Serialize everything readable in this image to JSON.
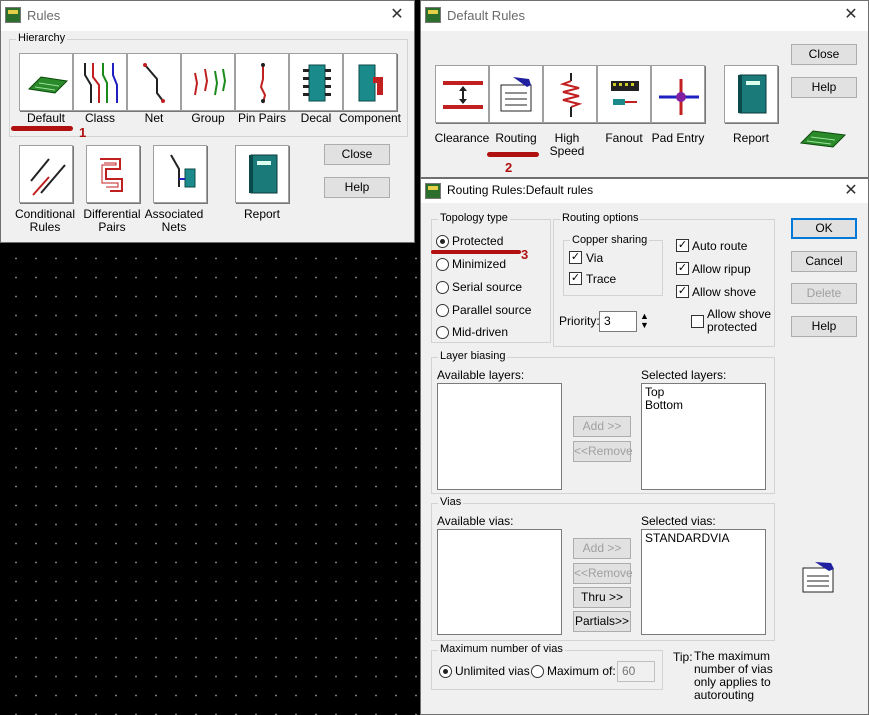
{
  "rules": {
    "title": "Rules",
    "hierarchy_label": "Hierarchy",
    "tiles": [
      {
        "label": "Default"
      },
      {
        "label": "Class"
      },
      {
        "label": "Net"
      },
      {
        "label": "Group"
      },
      {
        "label": "Pin Pairs"
      },
      {
        "label": "Decal"
      },
      {
        "label": "Component"
      }
    ],
    "tiles2": [
      {
        "label": "Conditional Rules"
      },
      {
        "label": "Differential Pairs"
      },
      {
        "label": "Associated Nets"
      },
      {
        "label": "Report"
      }
    ],
    "close_label": "Close",
    "help_label": "Help"
  },
  "default_rules": {
    "title": "Default Rules",
    "tiles": [
      {
        "label": "Clearance"
      },
      {
        "label": "Routing"
      },
      {
        "label": "High Speed"
      },
      {
        "label": "Fanout"
      },
      {
        "label": "Pad Entry"
      },
      {
        "label": "Report"
      }
    ],
    "close_label": "Close",
    "help_label": "Help"
  },
  "routing": {
    "title": "Routing Rules:Default rules",
    "topology_label": "Topology type",
    "topology_options": [
      "Protected",
      "Minimized",
      "Serial source",
      "Parallel source",
      "Mid-driven"
    ],
    "routing_options_label": "Routing options",
    "copper_sharing_label": "Copper sharing",
    "via_label": "Via",
    "trace_label": "Trace",
    "auto_route_label": "Auto route",
    "allow_ripup_label": "Allow ripup",
    "allow_shove_label": "Allow shove",
    "allow_shove_protected_label": "Allow shove protected",
    "priority_label": "Priority:",
    "priority_value": "3",
    "layer_biasing_label": "Layer biasing",
    "available_layers_label": "Available layers:",
    "selected_layers_label": "Selected layers:",
    "selected_layers": [
      "Top",
      "Bottom"
    ],
    "add_label": "Add >>",
    "remove_label": "<<Remove",
    "vias_label": "Vias",
    "available_vias_label": "Available vias:",
    "selected_vias_label": "Selected vias:",
    "selected_vias": [
      "STANDARDVIA"
    ],
    "thru_label": "Thru >>",
    "partials_label": "Partials>>",
    "max_vias_label": "Maximum number of vias",
    "unlimited_label": "Unlimited vias",
    "maximum_of_label": "Maximum of:",
    "maximum_value": "60",
    "tip_label": "Tip:",
    "tip_text": "The maximum number of vias only applies to autorouting",
    "ok_label": "OK",
    "cancel_label": "Cancel",
    "delete_label": "Delete",
    "help_label": "Help"
  },
  "annotations": [
    "1",
    "2",
    "3"
  ]
}
